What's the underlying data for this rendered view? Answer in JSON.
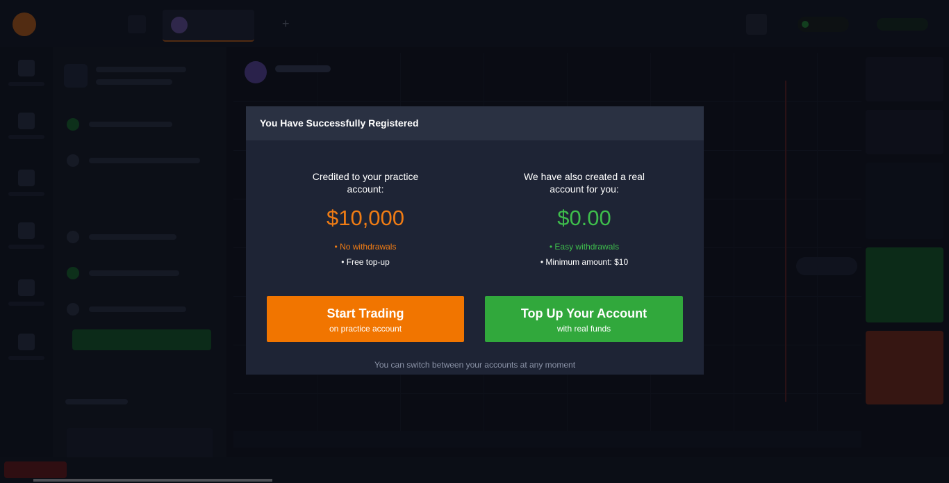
{
  "modal": {
    "title": "You Have Successfully Registered",
    "practice": {
      "heading": "Credited to your practice account:",
      "amount": "$10,000",
      "feature_1": "• No withdrawals",
      "feature_2": "• Free top-up"
    },
    "real": {
      "heading": "We have also created a real account for you:",
      "amount": "$0.00",
      "feature_1": "• Easy withdrawals",
      "feature_2": "• Minimum amount:  $10"
    },
    "start_button": {
      "label": "Start Trading",
      "sublabel": "on practice account"
    },
    "topup_button": {
      "label": "Top Up Your Account",
      "sublabel": "with real funds"
    },
    "footer_note": "You can switch between your accounts at any moment"
  },
  "colors": {
    "accent_orange": "#f17500",
    "accent_green": "#31a83c",
    "modal_bg": "#1e2435",
    "modal_header_bg": "#2a3142"
  }
}
